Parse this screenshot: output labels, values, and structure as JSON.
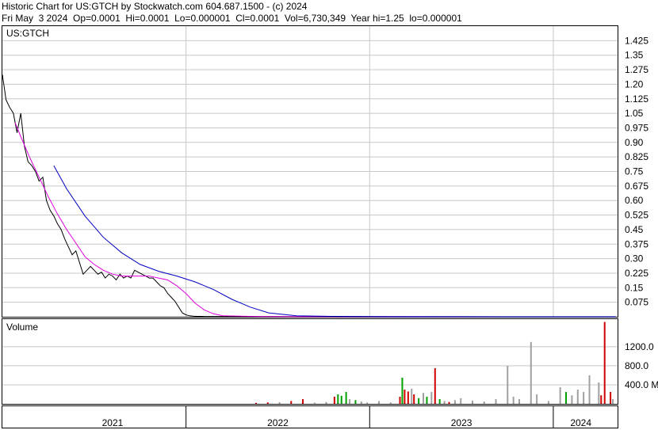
{
  "header": {
    "line1": "Historic Chart for US:GTCH by Stockwatch.com 604.687.1500 - (c) 2024",
    "line2": "Fri May  3 2024  Op=0.0001  Hi=0.0001  Lo=0.000001  Cl=0.0001  Vol=6,730,349  Year hi=1.25  lo=0.000001"
  },
  "chart_data": [
    {
      "type": "line",
      "title": "US:GTCH",
      "ylim": [
        0,
        1.5
      ],
      "y_ticks": [
        "1.425",
        "1.35",
        "1.275",
        "1.20",
        "1.125",
        "1.05",
        "0.975",
        "0.90",
        "0.825",
        "0.75",
        "0.675",
        "0.60",
        "0.525",
        "0.45",
        "0.375",
        "0.30",
        "0.225",
        "0.15",
        "0.075"
      ],
      "y_tick_values": [
        1.425,
        1.35,
        1.275,
        1.2,
        1.125,
        1.05,
        0.975,
        0.9,
        0.825,
        0.75,
        0.675,
        0.6,
        0.525,
        0.45,
        0.375,
        0.3,
        0.225,
        0.15,
        0.075
      ],
      "x_labels": [
        "2021",
        "2022",
        "2023",
        "2024"
      ],
      "x_label_years": [
        2021.6,
        2022.5,
        2023.5,
        2024.15
      ],
      "year_boundaries": [
        2022.0,
        2023.0,
        2024.0
      ],
      "x_range": [
        2021.0,
        2024.35
      ],
      "grid": true,
      "colors": {
        "price": "#000000",
        "ma_short": "#e000e0",
        "ma_long": "#0000c0",
        "grid": "#c8c8c8"
      },
      "series": [
        {
          "role": "price",
          "x": [
            2021.0,
            2021.02,
            2021.04,
            2021.06,
            2021.08,
            2021.1,
            2021.12,
            2021.14,
            2021.16,
            2021.18,
            2021.2,
            2021.22,
            2021.24,
            2021.26,
            2021.28,
            2021.3,
            2021.32,
            2021.34,
            2021.36,
            2021.38,
            2021.4,
            2021.42,
            2021.44,
            2021.46,
            2021.48,
            2021.5,
            2021.52,
            2021.54,
            2021.56,
            2021.58,
            2021.6,
            2021.62,
            2021.64,
            2021.66,
            2021.68,
            2021.7,
            2021.72,
            2021.74,
            2021.76,
            2021.78,
            2021.8,
            2021.82,
            2021.84,
            2021.86,
            2021.88,
            2021.9,
            2021.92,
            2021.94,
            2021.96,
            2021.98,
            2022.0,
            2022.02,
            2022.04,
            2022.06,
            2022.08,
            2022.1,
            2022.12,
            2022.14,
            2022.16,
            2022.18,
            2022.2,
            2022.22,
            2022.24,
            2022.26,
            2022.28,
            2022.3,
            2022.35,
            2022.4,
            2022.5,
            2022.6,
            2022.7,
            2022.8,
            2022.9,
            2023.0,
            2023.2,
            2023.4,
            2023.6,
            2023.8,
            2024.0,
            2024.2,
            2024.34
          ],
          "y": [
            1.25,
            1.12,
            1.08,
            1.05,
            0.95,
            1.05,
            0.88,
            0.8,
            0.78,
            0.75,
            0.7,
            0.72,
            0.6,
            0.55,
            0.52,
            0.48,
            0.45,
            0.4,
            0.36,
            0.32,
            0.34,
            0.28,
            0.22,
            0.24,
            0.26,
            0.24,
            0.22,
            0.23,
            0.2,
            0.22,
            0.21,
            0.19,
            0.22,
            0.2,
            0.21,
            0.2,
            0.24,
            0.23,
            0.22,
            0.21,
            0.2,
            0.2,
            0.18,
            0.16,
            0.15,
            0.12,
            0.1,
            0.08,
            0.05,
            0.02,
            0.01,
            0.005,
            0.003,
            0.002,
            0.002,
            0.001,
            0.001,
            0.001,
            0.001,
            0.001,
            0.001,
            0.001,
            0.001,
            0.001,
            0.001,
            0.001,
            0.0005,
            0.0005,
            0.0003,
            0.0002,
            0.0002,
            0.0001,
            0.0001,
            0.0001,
            0.0001,
            0.0001,
            0.0001,
            0.0001,
            0.0001,
            0.0001,
            0.0001
          ]
        },
        {
          "role": "moving-average-short",
          "x": [
            2021.07,
            2021.1,
            2021.15,
            2021.2,
            2021.25,
            2021.3,
            2021.35,
            2021.4,
            2021.45,
            2021.5,
            2021.55,
            2021.6,
            2021.65,
            2021.7,
            2021.75,
            2021.8,
            2021.85,
            2021.9,
            2021.95,
            2022.0,
            2022.05,
            2022.1,
            2022.15,
            2022.2,
            2022.4,
            2022.7,
            2023.0,
            2023.5,
            2024.0,
            2024.34
          ],
          "y": [
            1.0,
            0.93,
            0.82,
            0.72,
            0.62,
            0.53,
            0.45,
            0.38,
            0.31,
            0.27,
            0.24,
            0.22,
            0.21,
            0.21,
            0.21,
            0.21,
            0.2,
            0.19,
            0.16,
            0.12,
            0.07,
            0.035,
            0.015,
            0.005,
            0.001,
            0.0005,
            0.0003,
            0.0002,
            0.0001,
            0.0001
          ]
        },
        {
          "role": "moving-average-long",
          "x": [
            2021.28,
            2021.35,
            2021.45,
            2021.55,
            2021.65,
            2021.75,
            2021.85,
            2021.95,
            2022.05,
            2022.15,
            2022.25,
            2022.35,
            2022.45,
            2022.6,
            2022.8,
            2023.0,
            2023.5,
            2024.0,
            2024.34
          ],
          "y": [
            0.78,
            0.66,
            0.52,
            0.41,
            0.33,
            0.27,
            0.235,
            0.21,
            0.18,
            0.14,
            0.09,
            0.05,
            0.02,
            0.005,
            0.002,
            0.001,
            0.0005,
            0.0002,
            0.0001
          ]
        }
      ]
    },
    {
      "type": "bar",
      "title": "Volume",
      "y_ticks": [
        "1200.0",
        "800.0",
        "400.0 M"
      ],
      "y_tick_values": [
        1200,
        800,
        400
      ],
      "ylim": [
        0,
        1780
      ],
      "units": "M",
      "colors": {
        "up": "#00a000",
        "down": "#d00000",
        "flat": "#a0a0a0"
      },
      "bars": [
        {
          "x": 2022.35,
          "v": 20,
          "c": "down"
        },
        {
          "x": 2022.45,
          "v": 30,
          "c": "down"
        },
        {
          "x": 2022.55,
          "v": 35,
          "c": "flat"
        },
        {
          "x": 2022.65,
          "v": 60,
          "c": "down"
        },
        {
          "x": 2022.75,
          "v": 100,
          "c": "down"
        },
        {
          "x": 2022.85,
          "v": 25,
          "c": "flat"
        },
        {
          "x": 2022.95,
          "v": 40,
          "c": "flat"
        },
        {
          "x": 2023.02,
          "v": 150,
          "c": "down"
        },
        {
          "x": 2023.05,
          "v": 200,
          "c": "up"
        },
        {
          "x": 2023.08,
          "v": 170,
          "c": "up"
        },
        {
          "x": 2023.12,
          "v": 250,
          "c": "up"
        },
        {
          "x": 2023.15,
          "v": 100,
          "c": "flat"
        },
        {
          "x": 2023.2,
          "v": 80,
          "c": "up"
        },
        {
          "x": 2023.25,
          "v": 50,
          "c": "flat"
        },
        {
          "x": 2023.3,
          "v": 30,
          "c": "flat"
        },
        {
          "x": 2023.4,
          "v": 60,
          "c": "flat"
        },
        {
          "x": 2023.5,
          "v": 30,
          "c": "flat"
        },
        {
          "x": 2023.58,
          "v": 150,
          "c": "down"
        },
        {
          "x": 2023.6,
          "v": 550,
          "c": "up"
        },
        {
          "x": 2023.62,
          "v": 300,
          "c": "down"
        },
        {
          "x": 2023.65,
          "v": 260,
          "c": "down"
        },
        {
          "x": 2023.68,
          "v": 320,
          "c": "flat"
        },
        {
          "x": 2023.7,
          "v": 200,
          "c": "down"
        },
        {
          "x": 2023.74,
          "v": 120,
          "c": "up"
        },
        {
          "x": 2023.78,
          "v": 230,
          "c": "flat"
        },
        {
          "x": 2023.81,
          "v": 150,
          "c": "up"
        },
        {
          "x": 2023.85,
          "v": 250,
          "c": "flat"
        },
        {
          "x": 2023.88,
          "v": 750,
          "c": "down"
        },
        {
          "x": 2023.92,
          "v": 100,
          "c": "up"
        },
        {
          "x": 2023.96,
          "v": 60,
          "c": "flat"
        },
        {
          "x": 2024.0,
          "v": 40,
          "c": "down"
        },
        {
          "x": 2024.05,
          "v": 80,
          "c": "flat"
        },
        {
          "x": 2024.1,
          "v": 120,
          "c": "flat"
        },
        {
          "x": 2024.2,
          "v": 70,
          "c": "flat"
        },
        {
          "x": 2024.3,
          "v": 50,
          "c": "flat"
        },
        {
          "x": 2024.4,
          "v": 100,
          "c": "flat"
        },
        {
          "x": 2024.5,
          "v": 800,
          "c": "flat"
        },
        {
          "x": 2024.55,
          "v": 150,
          "c": "flat"
        },
        {
          "x": 2024.6,
          "v": 100,
          "c": "flat"
        },
        {
          "x": 2024.7,
          "v": 1300,
          "c": "flat"
        },
        {
          "x": 2024.75,
          "v": 200,
          "c": "flat"
        },
        {
          "x": 2024.85,
          "v": 60,
          "c": "flat"
        },
        {
          "x": 2024.95,
          "v": 350,
          "c": "flat"
        },
        {
          "x": 2025.0,
          "v": 250,
          "c": "up"
        },
        {
          "x": 2025.05,
          "v": 180,
          "c": "flat"
        },
        {
          "x": 2025.1,
          "v": 300,
          "c": "flat"
        },
        {
          "x": 2025.15,
          "v": 250,
          "c": "flat"
        },
        {
          "x": 2025.2,
          "v": 600,
          "c": "flat"
        },
        {
          "x": 2025.28,
          "v": 450,
          "c": "flat"
        },
        {
          "x": 2025.3,
          "v": 180,
          "c": "down"
        },
        {
          "x": 2025.33,
          "v": 1720,
          "c": "down"
        },
        {
          "x": 2025.38,
          "v": 250,
          "c": "down"
        },
        {
          "x": 2025.4,
          "v": 100,
          "c": "flat"
        }
      ]
    }
  ]
}
